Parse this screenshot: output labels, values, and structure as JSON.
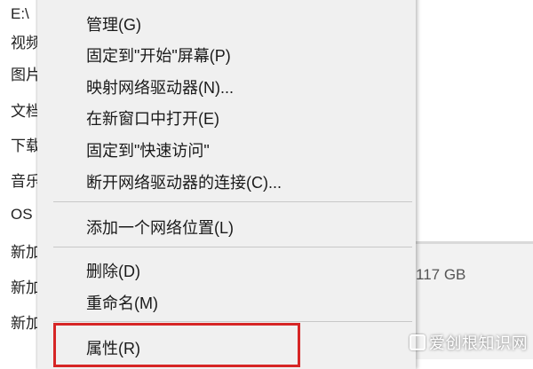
{
  "explorer": {
    "items": [
      "E:\\",
      "视频",
      "图片",
      "文档",
      "下载",
      "音乐",
      "OS",
      "新加",
      "新加",
      "新加"
    ],
    "storage_text": "117 GB"
  },
  "context_menu": {
    "group1": [
      "管理(G)",
      "固定到\"开始\"屏幕(P)",
      "映射网络驱动器(N)...",
      "在新窗口中打开(E)",
      "固定到\"快速访问\"",
      "断开网络驱动器的连接(C)..."
    ],
    "group2": [
      "添加一个网络位置(L)"
    ],
    "group3": [
      "删除(D)",
      "重命名(M)"
    ],
    "group4": [
      "属性(R)"
    ]
  },
  "highlight_color": "#d62525",
  "watermark": "爱创根知识网"
}
